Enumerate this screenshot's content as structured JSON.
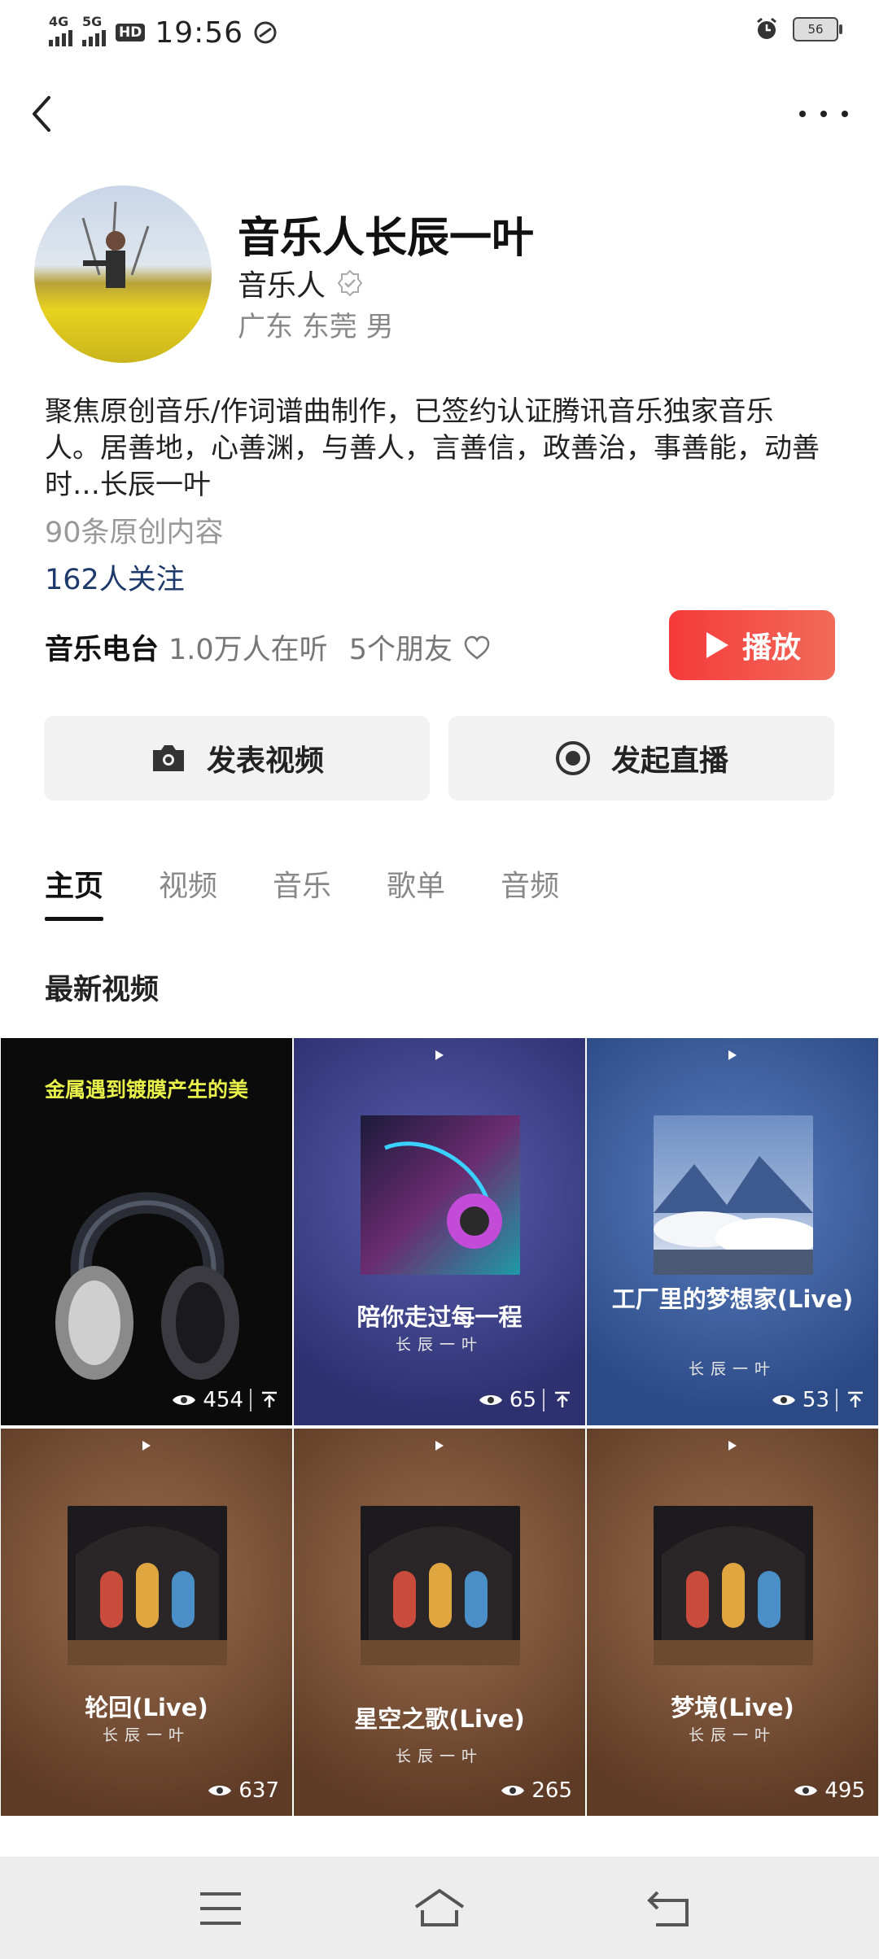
{
  "status_bar": {
    "net1": "4G",
    "net2": "5G",
    "hd": "HD",
    "time": "19:56",
    "battery": "56"
  },
  "profile": {
    "name": "音乐人长辰一叶",
    "tag": "音乐人",
    "location": "广东 东莞 男",
    "bio": "聚焦原创音乐/作词谱曲制作，已签约认证腾讯音乐独家音乐人。居善地，心善渊，与善人，言善信，政善治，事善能，动善时…长辰一叶",
    "content_count": "90条原创内容",
    "followers": "162人关注"
  },
  "radio": {
    "title": "音乐电台",
    "listeners": "1.0万人在听",
    "friends": "5个朋友",
    "play_label": "播放"
  },
  "actions": {
    "post_video": "发表视频",
    "start_live": "发起直播"
  },
  "tabs": [
    {
      "label": "主页"
    },
    {
      "label": "视频"
    },
    {
      "label": "音乐"
    },
    {
      "label": "歌单"
    },
    {
      "label": "音频"
    }
  ],
  "section_title": "最新视频",
  "videos": [
    {
      "overlay_text": "金属遇到镀膜产生的美",
      "title": "",
      "artist": "",
      "views": "454",
      "bg": "#111111"
    },
    {
      "overlay_text": "",
      "title": "陪你走过每一程",
      "artist": "长辰一叶",
      "views": "65",
      "bg": "#3b3f86"
    },
    {
      "overlay_text": "",
      "title": "工厂里的梦想家(Live)",
      "artist": "长辰一叶",
      "views": "53",
      "bg": "#3c5c99"
    },
    {
      "overlay_text": "",
      "title": "轮回(Live)",
      "artist": "长辰一叶",
      "views": "637",
      "bg": "#7a4f33"
    },
    {
      "overlay_text": "",
      "title": "星空之歌(Live)",
      "artist": "长辰一叶",
      "views": "265",
      "bg": "#7a4f33"
    },
    {
      "overlay_text": "",
      "title": "梦境(Live)",
      "artist": "长辰一叶",
      "views": "495",
      "bg": "#7a4f33"
    }
  ],
  "colors": {
    "accent": "#f0463f",
    "follow_link": "#1d3a6b"
  }
}
